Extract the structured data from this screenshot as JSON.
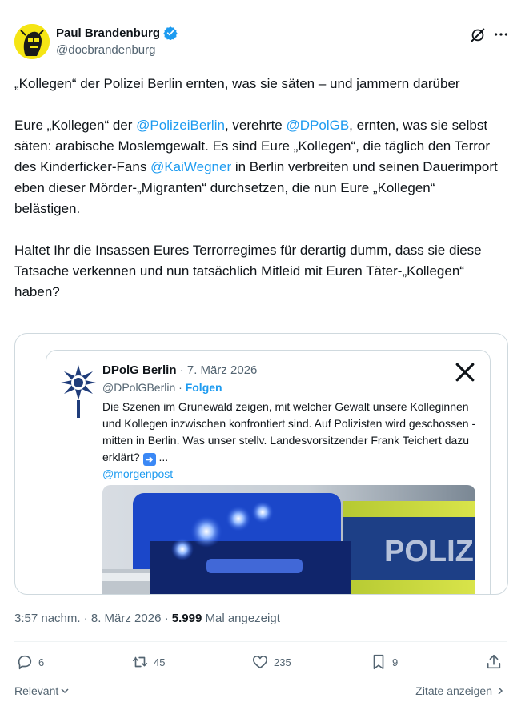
{
  "author": {
    "name": "Paul Brandenburg",
    "handle": "@docbrandenburg"
  },
  "header_icons": [
    "grok-icon",
    "more-icon"
  ],
  "tweet": {
    "title": "„Kollegen“ der Polizei Berlin ernten, was sie säten – und jammern darüber",
    "p1": {
      "t1": "Eure „Kollegen“ der ",
      "m1": "@PolizeiBerlin",
      "t2": ", verehrte ",
      "m2": "@DPolGB",
      "t3": ", ernten, was sie selbst säten: arabische Moslemgewalt. Es sind Eure „Kollegen“, die täglich den Terror des Kinderficker-Fans ",
      "m3": "@KaiWegner",
      "t4": " in Berlin verbreiten und seinen Dauerimport eben dieser Mörder-„Migranten“ durchsetzen, die nun Eure „Kollegen“ belästigen."
    },
    "p2": "Haltet Ihr die Insassen Eures Terrorregimes für derartig dumm, dass sie diese Tatsache verkennen und nun tatsächlich Mitleid mit Euren Täter-„Kollegen“ haben?"
  },
  "quote": {
    "name": "DPolG Berlin",
    "date": " · 7. März 2026",
    "handle": "@DPolGBerlin",
    "sep": " · ",
    "follow": "Folgen",
    "text": "Die Szenen im Grunewald zeigen, mit welcher Gewalt unsere Kolleginnen und Kollegen inzwischen konfrontiert sind. Auf Polizisten wird geschossen - mitten in Berlin. Was unser stellv. Landesvorsitzender Frank Teichert dazu erklärt? ",
    "ellipsis": " ...",
    "link": "@morgenpost",
    "image_text": "POLIZEI"
  },
  "meta": {
    "time": "3:57 nachm. · 8. März 2026 · ",
    "views": "5.999",
    "views_label": " Mal angezeigt"
  },
  "actions": {
    "replies": "6",
    "reposts": "45",
    "likes": "235",
    "bookmarks": "9"
  },
  "footer": {
    "sort": "Relevant",
    "quotes": "Zitate anzeigen"
  },
  "colors": {
    "accent": "#1d9bf0",
    "secondary_text": "#536471",
    "avatar_bg": "#f5e514"
  }
}
